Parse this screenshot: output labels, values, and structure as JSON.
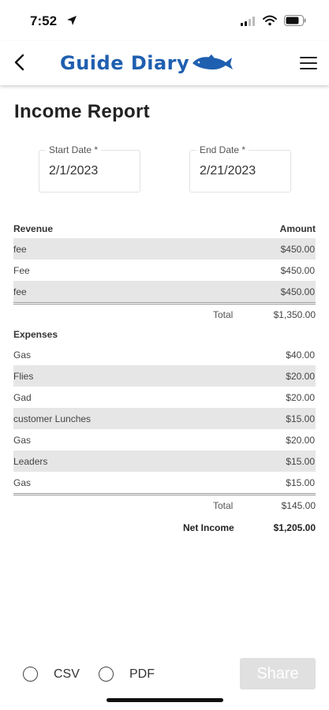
{
  "status_bar": {
    "time": "7:52"
  },
  "header": {
    "logo_text": "Guide Diary"
  },
  "page": {
    "title": "Income Report"
  },
  "dates": {
    "start_label": "Start Date *",
    "start_value": "2/1/2023",
    "end_label": "End Date *",
    "end_value": "2/21/2023"
  },
  "revenue": {
    "header_label": "Revenue",
    "header_amount": "Amount",
    "rows": [
      {
        "name": "fee",
        "amount": "$450.00"
      },
      {
        "name": "Fee",
        "amount": "$450.00"
      },
      {
        "name": "fee",
        "amount": "$450.00"
      }
    ],
    "total_label": "Total",
    "total_value": "$1,350.00"
  },
  "expenses": {
    "header_label": "Expenses",
    "rows": [
      {
        "name": "Gas",
        "amount": "$40.00"
      },
      {
        "name": "Flies",
        "amount": "$20.00"
      },
      {
        "name": "Gad",
        "amount": "$20.00"
      },
      {
        "name": "customer Lunches",
        "amount": "$15.00"
      },
      {
        "name": "Gas",
        "amount": "$20.00"
      },
      {
        "name": "Leaders",
        "amount": "$15.00"
      },
      {
        "name": "Gas",
        "amount": "$15.00"
      }
    ],
    "total_label": "Total",
    "total_value": "$145.00"
  },
  "net": {
    "label": "Net Income",
    "value": "$1,205.00"
  },
  "footer": {
    "csv_label": "CSV",
    "pdf_label": "PDF",
    "share_label": "Share"
  },
  "colors": {
    "brand": "#1f5fb0",
    "row_shade": "#e6e6e6",
    "disabled": "#e0e0e0"
  }
}
